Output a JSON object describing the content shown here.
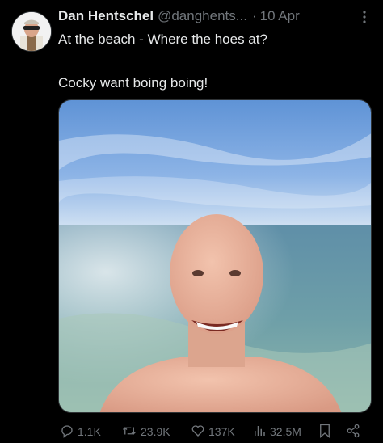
{
  "tweet": {
    "author_name": "Dan Hentschel",
    "handle": "@danghents...",
    "separator": "·",
    "date": "10 Apr",
    "text_line1": "At the beach - Where the hoes at?",
    "text_line2": "Cocky want boing boing!"
  },
  "actions": {
    "replies": "1.1K",
    "reposts": "23.9K",
    "likes": "137K",
    "views": "32.5M"
  },
  "icons": {
    "more": "more-dots-icon",
    "reply": "reply-icon",
    "repost": "repost-icon",
    "like": "heart-icon",
    "views": "views-chart-icon",
    "bookmark": "bookmark-icon",
    "share": "share-icon"
  },
  "colors": {
    "background": "#000000",
    "text": "#e7e9ea",
    "muted": "#71767b"
  }
}
